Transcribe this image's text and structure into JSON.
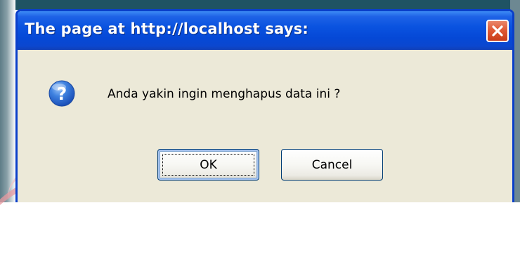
{
  "dialog": {
    "title": "The page at http://localhost says:",
    "message": "Anda yakin ingin menghapus data ini ?",
    "icon": "question-icon",
    "buttons": {
      "ok_label": "OK",
      "cancel_label": "Cancel"
    },
    "close_icon": "close-icon"
  },
  "colors": {
    "titlebar_blue": "#0a53e0",
    "dialog_face": "#ece9d8",
    "close_red": "#e05a35",
    "icon_blue": "#2f6fd6"
  }
}
